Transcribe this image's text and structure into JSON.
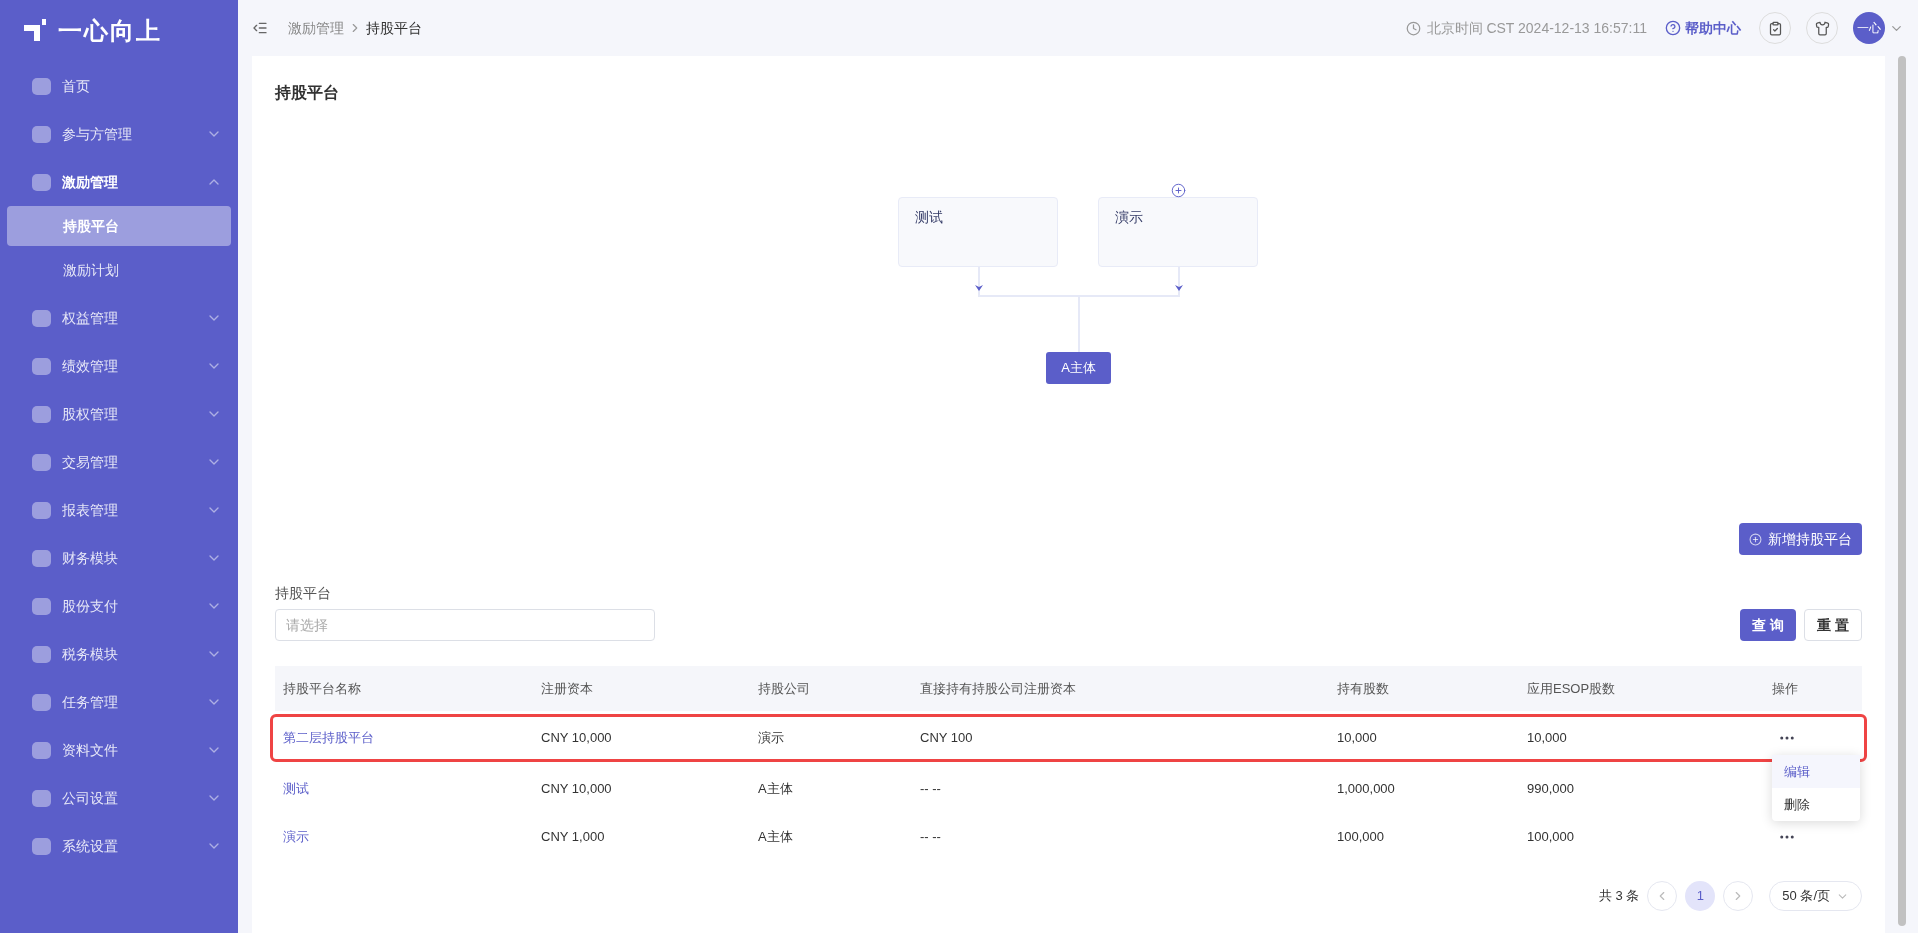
{
  "logo": {
    "text": "一心向上"
  },
  "sidebar": {
    "items": [
      {
        "label": "首页",
        "kind": "link"
      },
      {
        "label": "参与方管理",
        "kind": "group",
        "expanded": false
      },
      {
        "label": "激励管理",
        "kind": "group",
        "expanded": true,
        "children": [
          {
            "label": "持股平台",
            "selected": true
          },
          {
            "label": "激励计划",
            "selected": false
          }
        ]
      },
      {
        "label": "权益管理",
        "kind": "group",
        "expanded": false
      },
      {
        "label": "绩效管理",
        "kind": "group",
        "expanded": false
      },
      {
        "label": "股权管理",
        "kind": "group",
        "expanded": false
      },
      {
        "label": "交易管理",
        "kind": "group",
        "expanded": false
      },
      {
        "label": "报表管理",
        "kind": "group",
        "expanded": false
      },
      {
        "label": "财务模块",
        "kind": "group",
        "expanded": false
      },
      {
        "label": "股份支付",
        "kind": "group",
        "expanded": false
      },
      {
        "label": "税务模块",
        "kind": "group",
        "expanded": false
      },
      {
        "label": "任务管理",
        "kind": "group",
        "expanded": false
      },
      {
        "label": "资料文件",
        "kind": "group",
        "expanded": false
      },
      {
        "label": "公司设置",
        "kind": "group",
        "expanded": false
      },
      {
        "label": "系统设置",
        "kind": "group",
        "expanded": false
      }
    ]
  },
  "header": {
    "breadcrumb": [
      "激励管理",
      "持股平台"
    ],
    "time": "北京时间 CST 2024-12-13 16:57:11",
    "help": "帮助中心",
    "avatar": "一心"
  },
  "page": {
    "title": "持股平台"
  },
  "diagram": {
    "nodes": [
      {
        "label": "测试",
        "add_button": false
      },
      {
        "label": "演示",
        "add_button": true
      }
    ],
    "root": "A主体"
  },
  "add_button": "新增持股平台",
  "filter": {
    "label": "持股平台",
    "placeholder": "请选择",
    "buttons": [
      {
        "label": "查 询",
        "kind": "primary"
      },
      {
        "label": "重 置",
        "kind": "default"
      }
    ]
  },
  "table": {
    "columns": [
      "持股平台名称",
      "注册资本",
      "持股公司",
      "直接持有持股公司注册资本",
      "持有股数",
      "应用ESOP股数",
      "操作"
    ],
    "rows": [
      {
        "cells": [
          "第二层持股平台",
          "CNY 10,000",
          "演示",
          "CNY 100",
          "10,000",
          "10,000"
        ],
        "highlighted": true,
        "menu": [
          {
            "label": "编辑",
            "selected": true
          },
          {
            "label": "删除",
            "selected": false
          }
        ]
      },
      {
        "cells": [
          "测试",
          "CNY 10,000",
          "A主体",
          "-- --",
          "1,000,000",
          "990,000"
        ],
        "highlighted": false
      },
      {
        "cells": [
          "演示",
          "CNY 1,000",
          "A主体",
          "-- --",
          "100,000",
          "100,000"
        ],
        "highlighted": false
      }
    ]
  },
  "pagination": {
    "total": "共 3 条",
    "pages": [
      {
        "label": "1",
        "selected": true
      }
    ],
    "page_size": "50 条/页"
  }
}
